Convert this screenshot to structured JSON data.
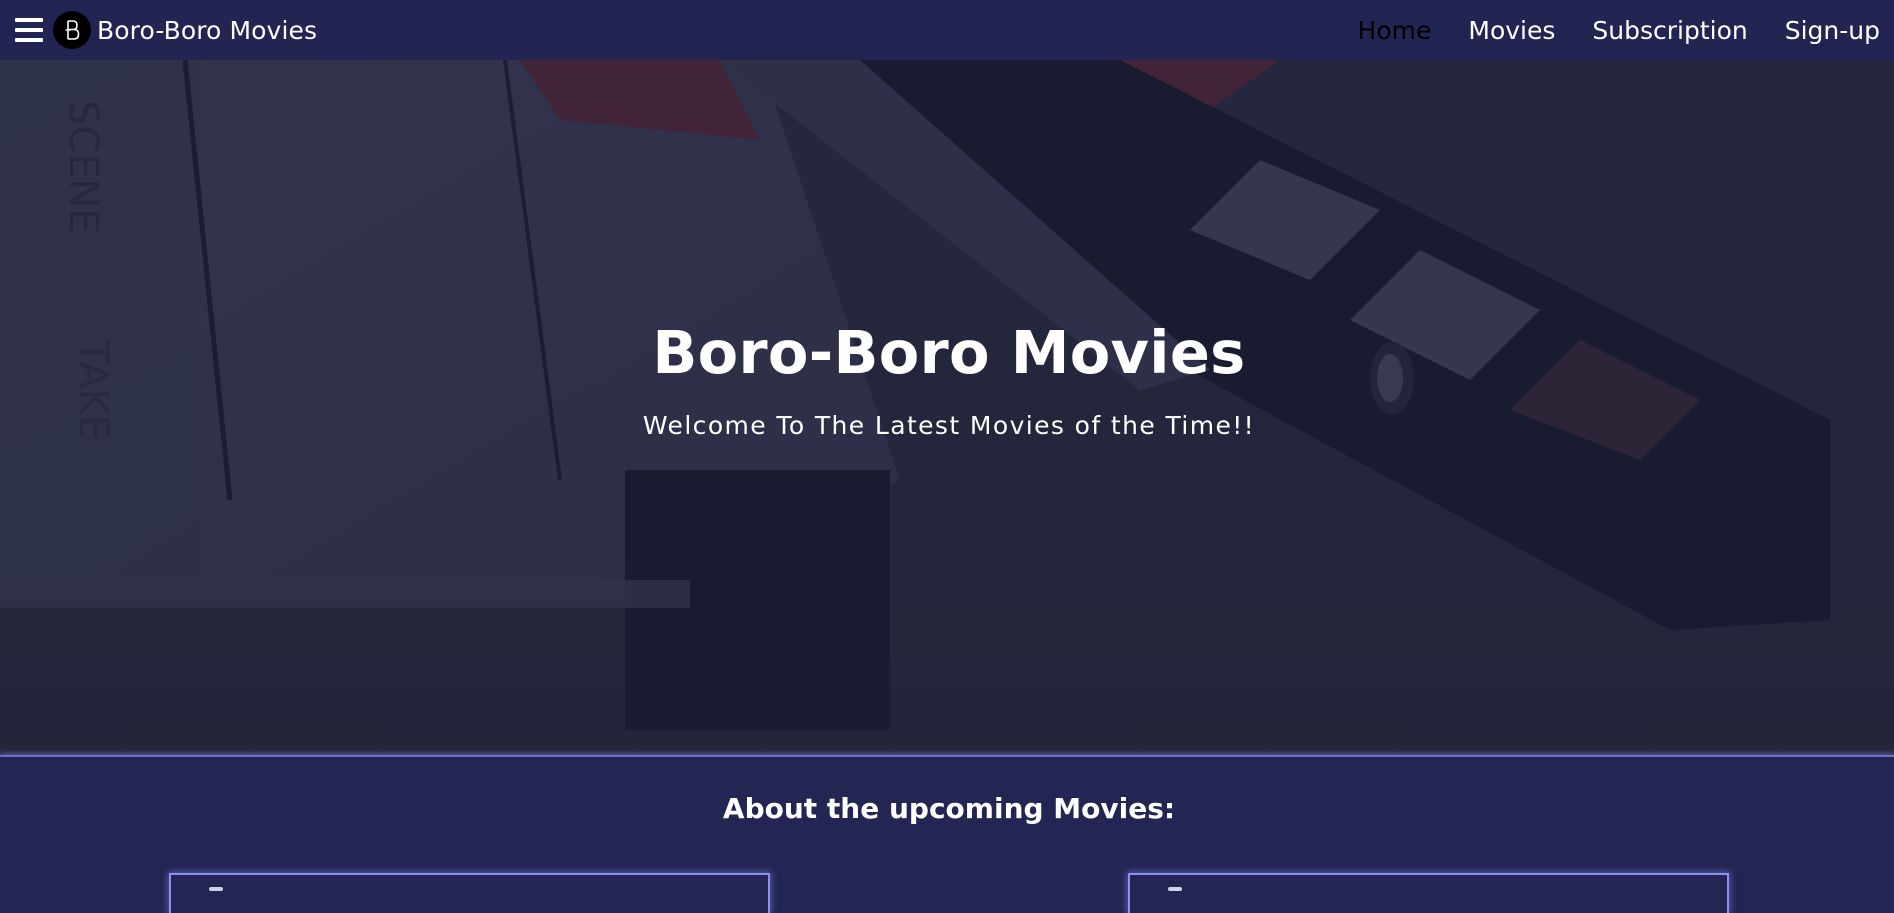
{
  "navbar": {
    "brand_name": "Boro-Boro Movies",
    "links": [
      "Home",
      "Movies",
      "Subscription",
      "Sign-up"
    ],
    "active_link": "Home",
    "icons": {
      "menu": "hamburger-menu-icon",
      "logo": "brand-logo-icon"
    }
  },
  "hero": {
    "title": "Boro-Boro Movies",
    "subtitle": "Welcome To The Latest Movies of the Time!!",
    "background": "film-clapperboard-photo"
  },
  "about": {
    "heading": "About the upcoming Movies:"
  },
  "colors": {
    "nav_background": "#222451",
    "section_background": "#232553",
    "accent_border": "#8c8ff2",
    "active_link": "#000000",
    "text": "#ffffff"
  }
}
